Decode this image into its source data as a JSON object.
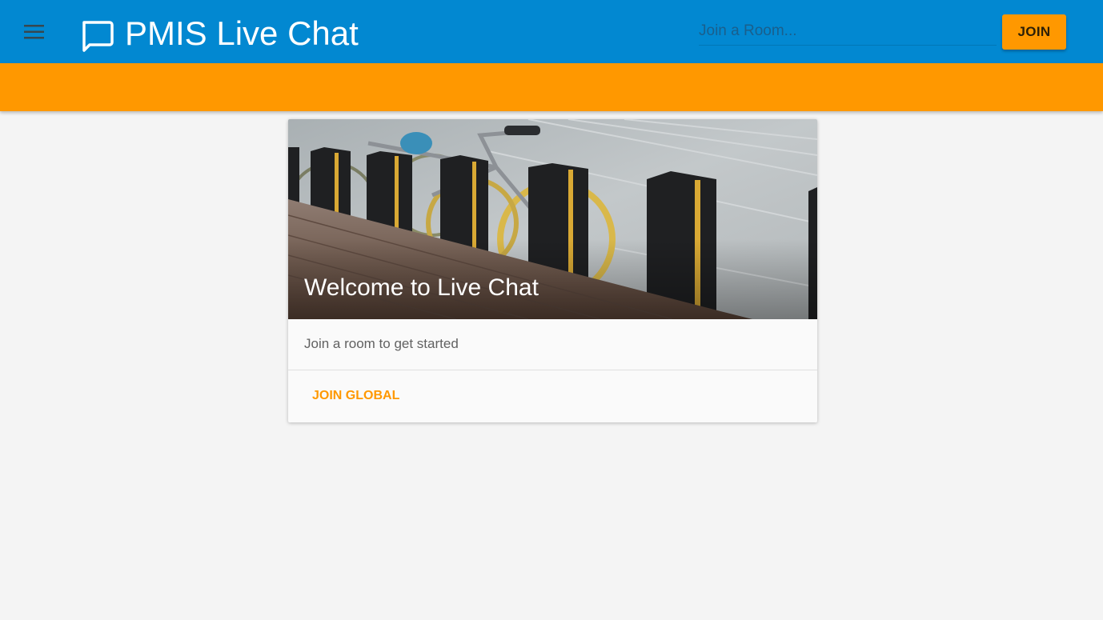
{
  "app": {
    "title": "PMIS Live Chat",
    "menu_icon": "menu-icon",
    "logo_icon": "chat-bubble-icon"
  },
  "search": {
    "placeholder": "Join a Room...",
    "value": ""
  },
  "toolbar": {
    "join_label": "JOIN"
  },
  "card": {
    "title": "Welcome to Live Chat",
    "text": "Join a room to get started",
    "action_label": "JOIN GLOBAL",
    "image_icon": "bicycle-rack-photo"
  },
  "colors": {
    "primary": "#0288d1",
    "accent": "#ff9800",
    "background": "#f4f4f4",
    "card": "#fafafa"
  }
}
